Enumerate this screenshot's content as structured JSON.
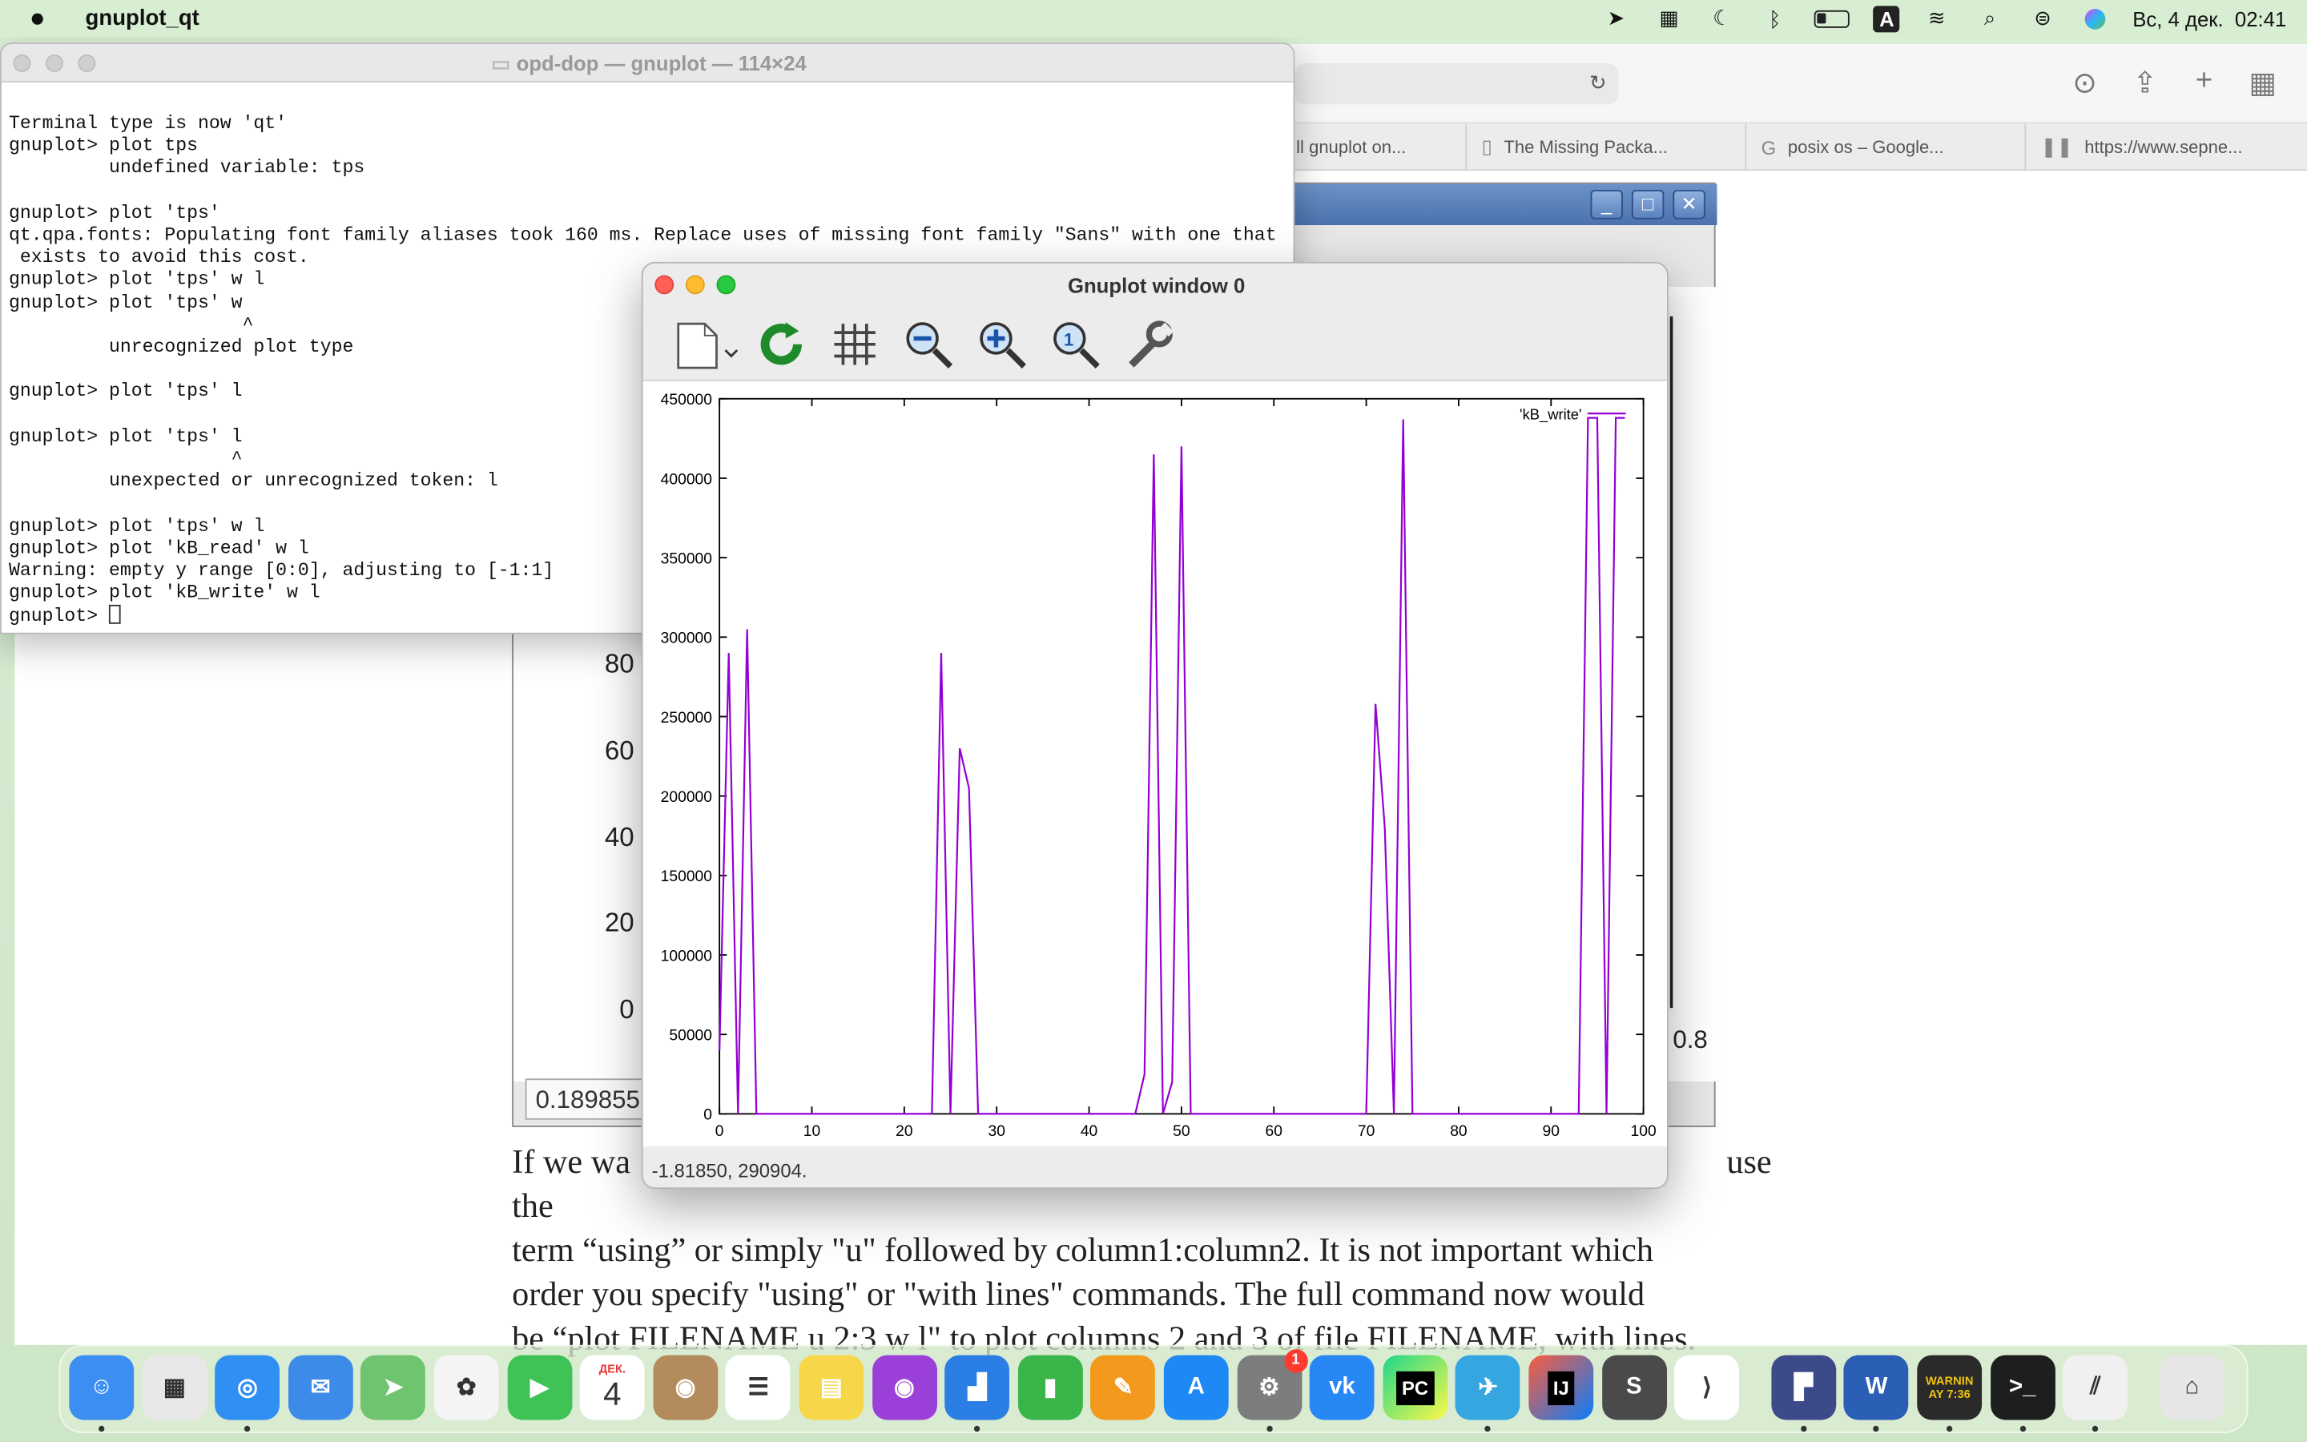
{
  "menubar": {
    "app_name": "gnuplot_qt",
    "clock": "Вс, 4 дек.  02:41",
    "status_icons": [
      "navigation-icon",
      "keyboard-icon",
      "moon-icon",
      "bluetooth-icon",
      "battery-icon",
      "input-source-icon",
      "wifi-icon",
      "spotlight-icon",
      "control-center-icon",
      "siri-icon"
    ],
    "input_source_letter": "A"
  },
  "safari": {
    "tabs": [
      {
        "label": "ll gnuplot on..."
      },
      {
        "label": "The Missing Packa..."
      },
      {
        "label": "posix os – Google..."
      },
      {
        "label": "https://www.sepne..."
      }
    ],
    "article_text": "If we wa… use the term “using” or simply \"u\" followed by column1:column2. It is not important which order you specify \"using\" or \"with lines\" commands. The full command now would be “plot FILENAME u 2:3 w l\" to plot columns 2 and 3 of file FILENAME, with lines.",
    "article_line1_start": "If we wa",
    "article_line1_end": "use the",
    "article_line2": "term “using” or simply \"u\" followed by column1:column2. It is not important which",
    "article_line3": "order you specify \"using\" or \"with lines\" commands. The full command now would",
    "article_line4": "be “plot FILENAME u 2:3 w l\" to plot columns 2 and 3 of file FILENAME, with lines."
  },
  "old_plot_window": {
    "ytick_labels": [
      "80",
      "60",
      "40",
      "20",
      "0"
    ],
    "status_value": "0.189855",
    "right_tick": "0.8"
  },
  "terminal": {
    "title": "opd-dop — gnuplot — 114×24",
    "lines": [
      "Terminal type is now 'qt'",
      "gnuplot> plot tps",
      "         undefined variable: tps",
      "",
      "gnuplot> plot 'tps'",
      "qt.qpa.fonts: Populating font family aliases took 160 ms. Replace uses of missing font family \"Sans\" with one that",
      " exists to avoid this cost.",
      "gnuplot> plot 'tps' w l",
      "gnuplot> plot 'tps' w",
      "                     ^",
      "         unrecognized plot type",
      "",
      "gnuplot> plot 'tps' l",
      "",
      "gnuplot> plot 'tps' l",
      "                    ^",
      "         unexpected or unrecognized token: l",
      "",
      "gnuplot> plot 'tps' w l",
      "gnuplot> plot 'kB_read' w l",
      "Warning: empty y range [0:0], adjusting to [-1:1]",
      "gnuplot> plot 'kB_write' w l",
      "gnuplot> "
    ]
  },
  "gnuplot_window": {
    "title": "Gnuplot window 0",
    "status_text": "-1.81850,  290904.",
    "toolbar": [
      "export-icon",
      "replot-icon",
      "grid-icon",
      "zoom-out-icon",
      "zoom-in-icon",
      "autoscale-icon",
      "settings-wrench-icon"
    ]
  },
  "chart_data": {
    "type": "line",
    "legend": "'kB_write'",
    "legend_position": "top-right",
    "color": "#9400d3",
    "xlim": [
      0,
      100
    ],
    "ylim": [
      0,
      450000
    ],
    "xticks": [
      0,
      10,
      20,
      30,
      40,
      50,
      60,
      70,
      80,
      90,
      100
    ],
    "yticks": [
      0,
      50000,
      100000,
      150000,
      200000,
      250000,
      300000,
      350000,
      400000,
      450000
    ],
    "grid": false,
    "series": [
      {
        "name": "'kB_write'",
        "x": [
          0,
          1,
          2,
          3,
          4,
          5,
          6,
          7,
          8,
          9,
          10,
          11,
          12,
          13,
          14,
          15,
          16,
          17,
          18,
          19,
          20,
          21,
          22,
          23,
          24,
          25,
          26,
          27,
          28,
          29,
          30,
          31,
          32,
          33,
          34,
          35,
          36,
          37,
          38,
          39,
          40,
          41,
          42,
          43,
          44,
          45,
          46,
          47,
          48,
          49,
          50,
          51,
          52,
          53,
          54,
          55,
          56,
          57,
          58,
          59,
          60,
          61,
          62,
          63,
          64,
          65,
          66,
          67,
          68,
          69,
          70,
          71,
          72,
          73,
          74,
          75,
          76,
          77,
          78,
          79,
          80,
          81,
          82,
          83,
          84,
          85,
          86,
          87,
          88,
          89,
          90,
          91,
          92,
          93,
          94,
          95,
          96,
          97,
          98
        ],
        "y": [
          40000,
          290000,
          0,
          305000,
          0,
          0,
          0,
          0,
          0,
          0,
          0,
          0,
          0,
          0,
          0,
          0,
          0,
          0,
          0,
          0,
          0,
          0,
          0,
          0,
          290000,
          0,
          230000,
          205000,
          0,
          0,
          0,
          0,
          0,
          0,
          0,
          0,
          0,
          0,
          0,
          0,
          0,
          0,
          0,
          0,
          0,
          0,
          25000,
          415000,
          0,
          20000,
          420000,
          0,
          0,
          0,
          0,
          0,
          0,
          0,
          0,
          0,
          0,
          0,
          0,
          0,
          0,
          0,
          0,
          0,
          0,
          0,
          0,
          258000,
          180000,
          0,
          437000,
          0,
          0,
          0,
          0,
          0,
          0,
          0,
          0,
          0,
          0,
          0,
          0,
          0,
          0,
          0,
          0,
          0,
          0,
          0,
          438000,
          438000,
          0,
          438000,
          438000
        ]
      }
    ]
  },
  "dock": {
    "calendar_month": "ДЕК.",
    "calendar_day": "4",
    "settings_badge": "1",
    "apps": [
      "finder-icon",
      "launchpad-icon",
      "safari-icon",
      "mail-icon",
      "maps-icon",
      "photos-icon",
      "facetime-icon",
      "calendar-icon",
      "contacts-icon",
      "reminders-icon",
      "notes-icon",
      "podcasts-icon",
      "keynote-icon",
      "numbers-icon",
      "pages-icon",
      "app-store-icon",
      "system-settings-icon",
      "vk-icon",
      "pycharm-icon",
      "telegram-icon",
      "intellij-icon",
      "sublime-icon",
      "vscode-icon",
      "preview-icon",
      "word-icon",
      "console-icon",
      "terminal-icon",
      "gnuplot-icon",
      "trash-icon"
    ],
    "pycharm_label": "PC",
    "intellij_label": "IJ",
    "word_label": "W",
    "console_label": "WARNIN\nAY 7:36",
    "terminal_label": ">_"
  }
}
